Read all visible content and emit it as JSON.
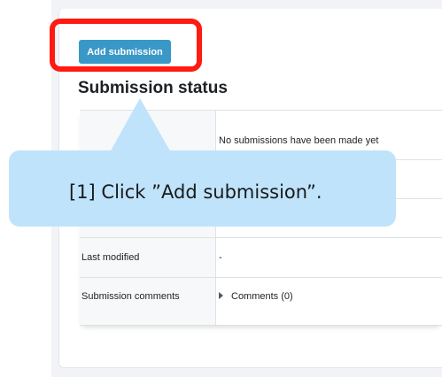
{
  "submission": {
    "add_button_label": "Add submission",
    "section_title": "Submission status",
    "rows": [
      {
        "label": "",
        "value": "No submissions have been made yet"
      },
      {
        "label": "",
        "value": ""
      },
      {
        "label": "",
        "value": ""
      },
      {
        "label": "Last modified",
        "value": "-"
      },
      {
        "label": "Submission comments",
        "value": "Comments (0)"
      }
    ]
  },
  "tutorial": {
    "callout_text": "[1] Click ”Add submission”.",
    "highlight_color": "#ff1a12",
    "callout_color": "#bfe3fb"
  },
  "colors": {
    "accent_button": "#3a98c6",
    "link": "#1177c4"
  }
}
